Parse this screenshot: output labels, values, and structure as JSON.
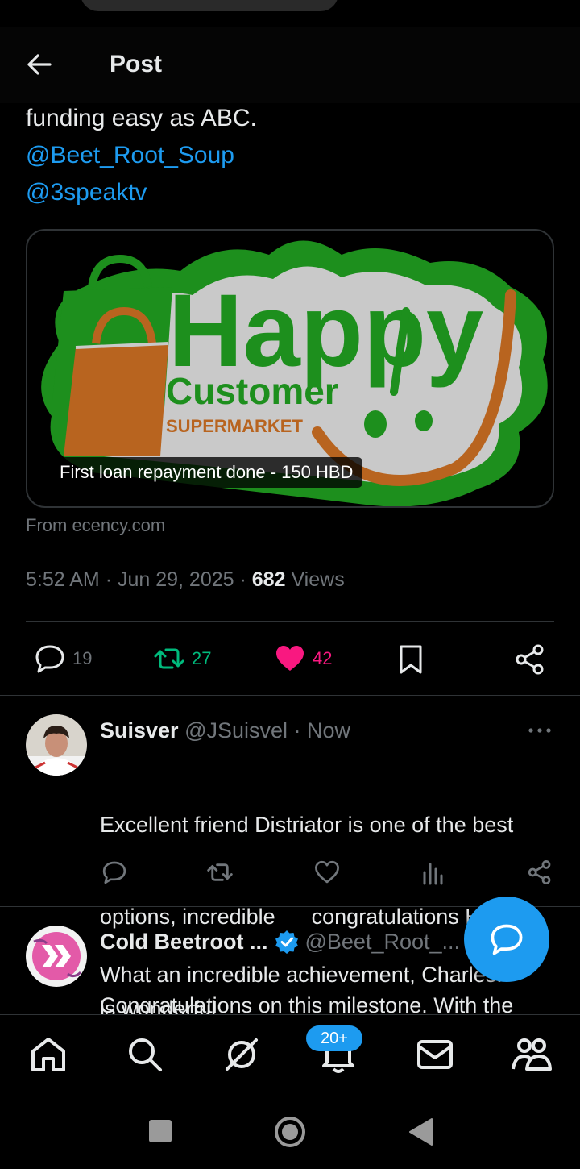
{
  "header": {
    "title": "Post",
    "back_icon": "arrow-left-icon"
  },
  "post": {
    "text_line": "funding easy as ABC.",
    "mentions": [
      "@Beet_Root_Soup",
      "@3speaktv"
    ],
    "card": {
      "logo": {
        "word1": "Happy",
        "word2": "Customer",
        "word3": "SUPERMARKET"
      },
      "caption": "First loan repayment done - 150 HBD",
      "source": "From ecency.com"
    },
    "meta": {
      "time": "5:52 AM",
      "sep": "·",
      "date": "Jun 29, 2025",
      "views_count": "682",
      "views_label": "Views"
    },
    "actions": {
      "replies": "19",
      "reposts": "27",
      "likes": "42"
    }
  },
  "comments": [
    {
      "name": "Suisver",
      "handle": "@JSuisvel",
      "time": "· Now",
      "lines": [
        "Excellent friend Distriator is one of the best",
        "options, incredible      congratulations Hive",
        "is wonderful"
      ]
    },
    {
      "name": "Cold Beetroot ...",
      "handle": "@Beet_Root_...",
      "lines": [
        "What an incredible achievement, Charles!",
        "Congratulations on this milestone. With the"
      ]
    }
  ],
  "bottom_nav": {
    "items": [
      "home-icon",
      "search-icon",
      "grok-icon",
      "notifications-icon",
      "messages-icon",
      "communities-icon"
    ],
    "notif_badge": "20+"
  },
  "colors": {
    "accent": "#1d9bf0",
    "retweet": "#00ba7c",
    "like": "#f91880",
    "muted": "#71767b"
  }
}
